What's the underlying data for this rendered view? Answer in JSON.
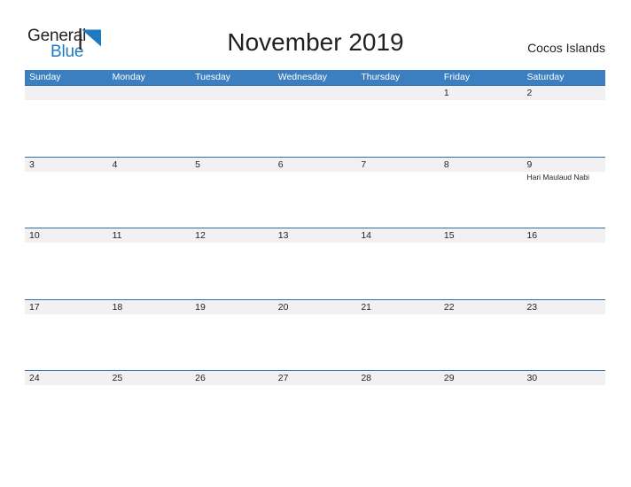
{
  "branding": {
    "word_one": "General",
    "word_two": "Blue",
    "flag_icon": "flag-triangle-icon",
    "color_dark": "#231f20",
    "color_blue": "#1f7ac0"
  },
  "header": {
    "title": "November 2019",
    "region": "Cocos Islands"
  },
  "theme": {
    "header_blue": "#3c7fc0",
    "row_divider_blue": "#2f6fb0",
    "number_band_gray": "#f1f1f1",
    "text_dark": "#231f20"
  },
  "calendar": {
    "day_headers": [
      "Sunday",
      "Monday",
      "Tuesday",
      "Wednesday",
      "Thursday",
      "Friday",
      "Saturday"
    ],
    "weeks": [
      {
        "days": [
          {
            "number": "",
            "event": ""
          },
          {
            "number": "",
            "event": ""
          },
          {
            "number": "",
            "event": ""
          },
          {
            "number": "",
            "event": ""
          },
          {
            "number": "",
            "event": ""
          },
          {
            "number": "1",
            "event": ""
          },
          {
            "number": "2",
            "event": ""
          }
        ]
      },
      {
        "days": [
          {
            "number": "3",
            "event": ""
          },
          {
            "number": "4",
            "event": ""
          },
          {
            "number": "5",
            "event": ""
          },
          {
            "number": "6",
            "event": ""
          },
          {
            "number": "7",
            "event": ""
          },
          {
            "number": "8",
            "event": ""
          },
          {
            "number": "9",
            "event": "Hari Maulaud Nabi"
          }
        ]
      },
      {
        "days": [
          {
            "number": "10",
            "event": ""
          },
          {
            "number": "11",
            "event": ""
          },
          {
            "number": "12",
            "event": ""
          },
          {
            "number": "13",
            "event": ""
          },
          {
            "number": "14",
            "event": ""
          },
          {
            "number": "15",
            "event": ""
          },
          {
            "number": "16",
            "event": ""
          }
        ]
      },
      {
        "days": [
          {
            "number": "17",
            "event": ""
          },
          {
            "number": "18",
            "event": ""
          },
          {
            "number": "19",
            "event": ""
          },
          {
            "number": "20",
            "event": ""
          },
          {
            "number": "21",
            "event": ""
          },
          {
            "number": "22",
            "event": ""
          },
          {
            "number": "23",
            "event": ""
          }
        ]
      },
      {
        "days": [
          {
            "number": "24",
            "event": ""
          },
          {
            "number": "25",
            "event": ""
          },
          {
            "number": "26",
            "event": ""
          },
          {
            "number": "27",
            "event": ""
          },
          {
            "number": "28",
            "event": ""
          },
          {
            "number": "29",
            "event": ""
          },
          {
            "number": "30",
            "event": ""
          }
        ]
      }
    ]
  }
}
